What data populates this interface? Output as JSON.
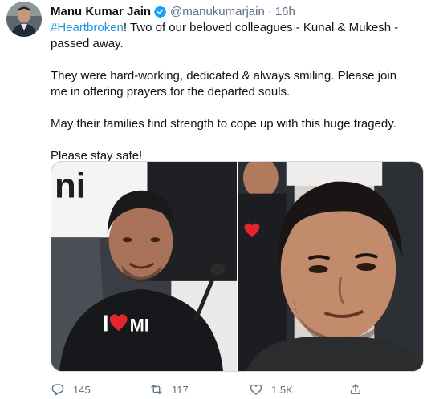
{
  "tweet": {
    "display_name": "Manu Kumar Jain",
    "handle": "@manukumarjain",
    "separator": "·",
    "time": "16h",
    "hashtag": "#Heartbroken",
    "line1_rest": "! Two of our beloved colleagues - Kunal & Mukesh - passed away.",
    "paragraph2": "They were hard-working, dedicated & always smiling. Please join me in offering prayers for the departed souls.",
    "paragraph3": "May their families find strength to cope up with this huge tragedy.",
    "paragraph4": "Please stay safe!"
  },
  "media": {
    "left_photo_shirt_text": "MI",
    "left_photo_banner_text": "ni"
  },
  "actions": {
    "reply_count": "145",
    "retweet_count": "117",
    "like_count": "1.5K",
    "share_label": ""
  },
  "colors": {
    "hashtag": "#1b95e0",
    "verified": "#1da1f2",
    "muted": "#5b7083"
  }
}
